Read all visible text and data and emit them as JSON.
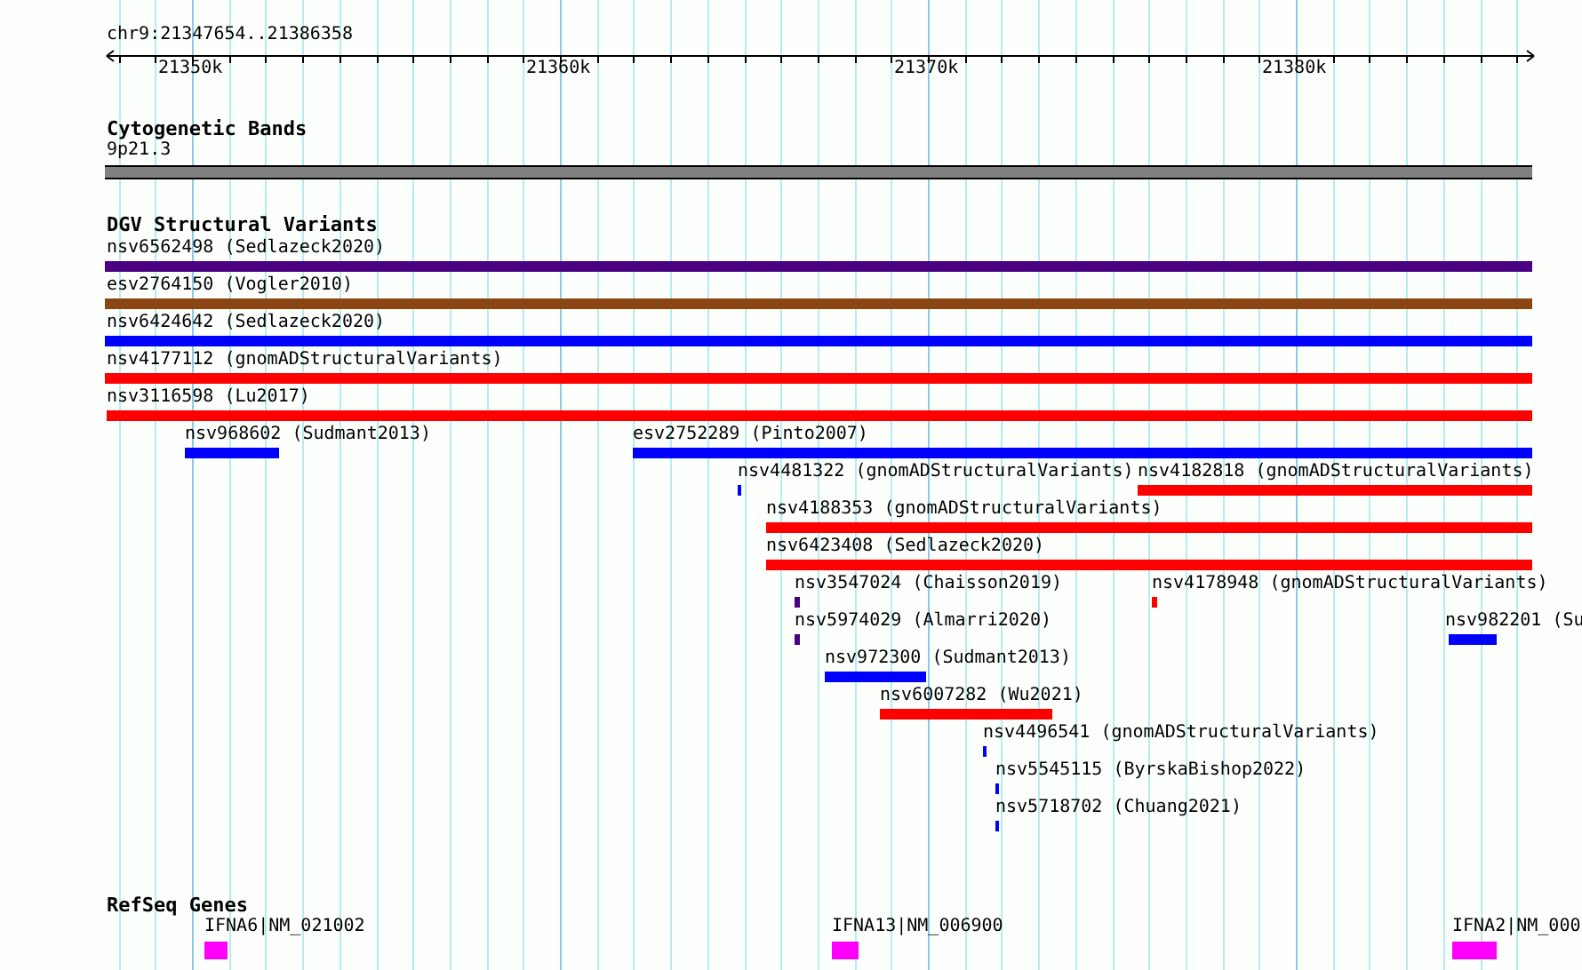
{
  "ruler": {
    "location": "chr9:21347654..21386358",
    "ticks": [
      "21350k",
      "21360k",
      "21370k",
      "21380k"
    ]
  },
  "cytoband_track": {
    "title": "Cytogenetic Bands",
    "band": "9p21.3"
  },
  "variant_track": {
    "title": "DGV Structural Variants",
    "features": [
      {
        "label": "nsv6562498 (Sedlazeck2020)",
        "color": "#4b0082"
      },
      {
        "label": "esv2764150 (Vogler2010)",
        "color": "#8b4513"
      },
      {
        "label": "nsv6424642 (Sedlazeck2020)",
        "color": "#0000ff"
      },
      {
        "label": "nsv4177112 (gnomADStructuralVariants)",
        "color": "#ff0000"
      },
      {
        "label": "nsv3116598 (Lu2017)",
        "color": "#ff0000"
      },
      {
        "label": "nsv968602 (Sudmant2013)",
        "color": "#0000ff"
      },
      {
        "label": "esv2752289 (Pinto2007)",
        "color": "#0000ff"
      },
      {
        "label": "nsv4481322 (gnomADStructuralVariants)",
        "color": "#0000ff"
      },
      {
        "label": "nsv4182818 (gnomADStructuralVariants)",
        "color": "#ff0000"
      },
      {
        "label": "nsv4188353 (gnomADStructuralVariants)",
        "color": "#ff0000"
      },
      {
        "label": "nsv6423408 (Sedlazeck2020)",
        "color": "#ff0000"
      },
      {
        "label": "nsv3547024 (Chaisson2019)",
        "color": "#4b0082"
      },
      {
        "label": "nsv4178948 (gnomADStructuralVariants)",
        "color": "#ff0000"
      },
      {
        "label": "nsv5974029 (Almarri2020)",
        "color": "#4b0082"
      },
      {
        "label": "nsv982201 (Su",
        "color": "#0000ff"
      },
      {
        "label": "nsv972300 (Sudmant2013)",
        "color": "#0000ff"
      },
      {
        "label": "nsv6007282 (Wu2021)",
        "color": "#ff0000"
      },
      {
        "label": "nsv4496541 (gnomADStructuralVariants)",
        "color": "#0000ff"
      },
      {
        "label": "nsv5545115 (ByrskaBishop2022)",
        "color": "#0000ff"
      },
      {
        "label": "nsv5718702 (Chuang2021)",
        "color": "#0000ff"
      }
    ]
  },
  "gene_track": {
    "title": "RefSeq Genes",
    "genes": [
      {
        "label": "IFNA6|NM_021002"
      },
      {
        "label": "IFNA13|NM_006900"
      },
      {
        "label": "IFNA2|NM_000"
      }
    ]
  }
}
